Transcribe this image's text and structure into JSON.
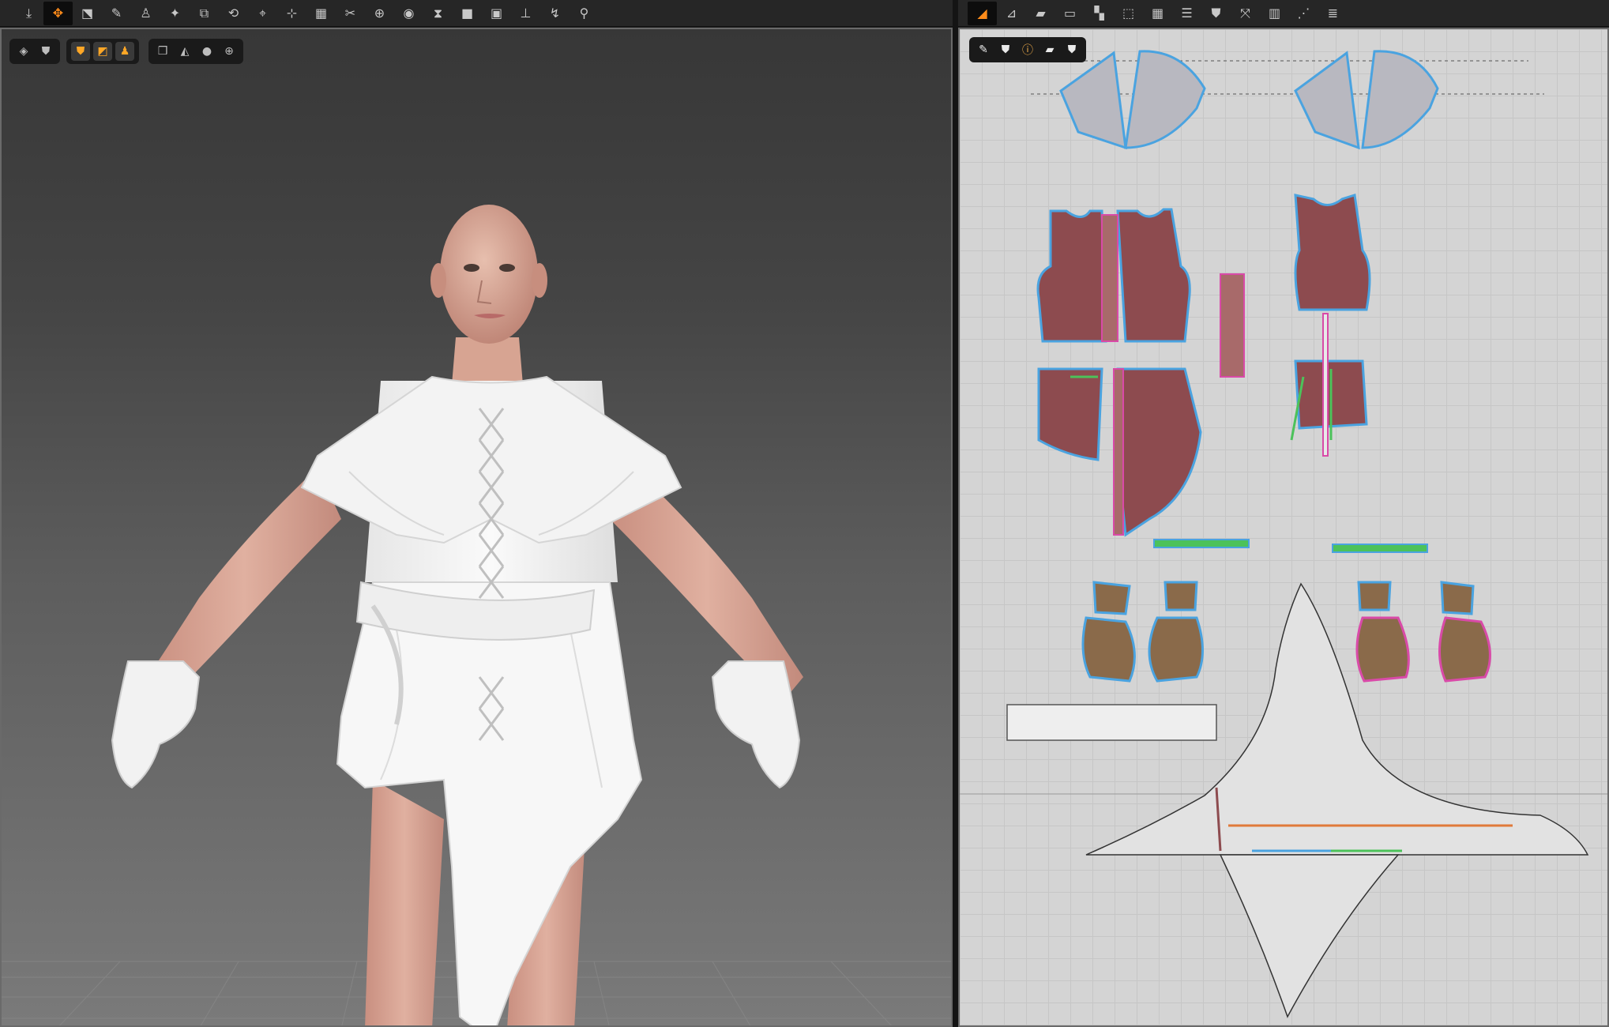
{
  "toolbar_3d": {
    "tools": [
      {
        "name": "download-icon",
        "active": false
      },
      {
        "name": "select-move-icon",
        "active": true
      },
      {
        "name": "transform-icon",
        "active": false
      },
      {
        "name": "brush-icon",
        "active": false
      },
      {
        "name": "avatar-icon",
        "active": false
      },
      {
        "name": "wand-icon",
        "active": false
      },
      {
        "name": "garment-fold-icon",
        "active": false
      },
      {
        "name": "garment-flip-icon",
        "active": false
      },
      {
        "name": "pin-icon",
        "active": false
      },
      {
        "name": "tack-icon",
        "active": false
      },
      {
        "name": "grid-select-icon",
        "active": false
      },
      {
        "name": "scissors-icon",
        "active": false
      },
      {
        "name": "sewing-icon",
        "active": false
      },
      {
        "name": "button-icon",
        "active": false
      },
      {
        "name": "zipper-icon",
        "active": false
      },
      {
        "name": "square-icon",
        "active": false
      },
      {
        "name": "square-alt-icon",
        "active": false
      },
      {
        "name": "measure-icon",
        "active": false
      },
      {
        "name": "hook-icon",
        "active": false
      },
      {
        "name": "walk-icon",
        "active": false
      }
    ]
  },
  "toolbar_2d": {
    "tools": [
      {
        "name": "edit-pattern-icon",
        "active": true
      },
      {
        "name": "edit-point-icon",
        "active": false
      },
      {
        "name": "polygon-icon",
        "active": false
      },
      {
        "name": "rectangle-icon",
        "active": false
      },
      {
        "name": "internal-polygon-icon",
        "active": false
      },
      {
        "name": "trace-icon",
        "active": false
      },
      {
        "name": "grid-icon",
        "active": false
      },
      {
        "name": "fold-icon",
        "active": false
      },
      {
        "name": "shirt-icon",
        "active": false
      },
      {
        "name": "segment-sew-icon",
        "active": false
      },
      {
        "name": "pleat-icon",
        "active": false
      },
      {
        "name": "ruler-icon",
        "active": false
      },
      {
        "name": "tape-icon",
        "active": false
      }
    ]
  },
  "viewport_tools": {
    "group1": [
      {
        "name": "cube-view-icon",
        "on": false
      },
      {
        "name": "garment-view-icon",
        "on": false
      }
    ],
    "group2": [
      {
        "name": "shirt-orange-icon",
        "on": true
      },
      {
        "name": "texture-icon",
        "on": true
      },
      {
        "name": "avatar-orange-icon",
        "on": true
      }
    ],
    "group3": [
      {
        "name": "layers-icon",
        "on": false
      },
      {
        "name": "fabric-icon",
        "on": false
      },
      {
        "name": "skin-icon",
        "on": false
      },
      {
        "name": "globe-icon",
        "on": false
      }
    ]
  },
  "pattern_tools": [
    {
      "name": "pen-icon",
      "on": false
    },
    {
      "name": "shirt-white-icon",
      "on": false
    },
    {
      "name": "info-icon",
      "on": false
    },
    {
      "name": "eraser-icon",
      "on": false
    },
    {
      "name": "shirt-lock-icon",
      "on": false
    }
  ],
  "colors": {
    "fabric_red": "#8d4b4f",
    "fabric_grey": "#b8b8c0",
    "glove_brown": "#8a6a4a",
    "seam_blue": "#4aa3e0",
    "seam_pink": "#d94aa8",
    "seam_green": "#4cc25a",
    "accent_orange": "#ff8c1a"
  }
}
